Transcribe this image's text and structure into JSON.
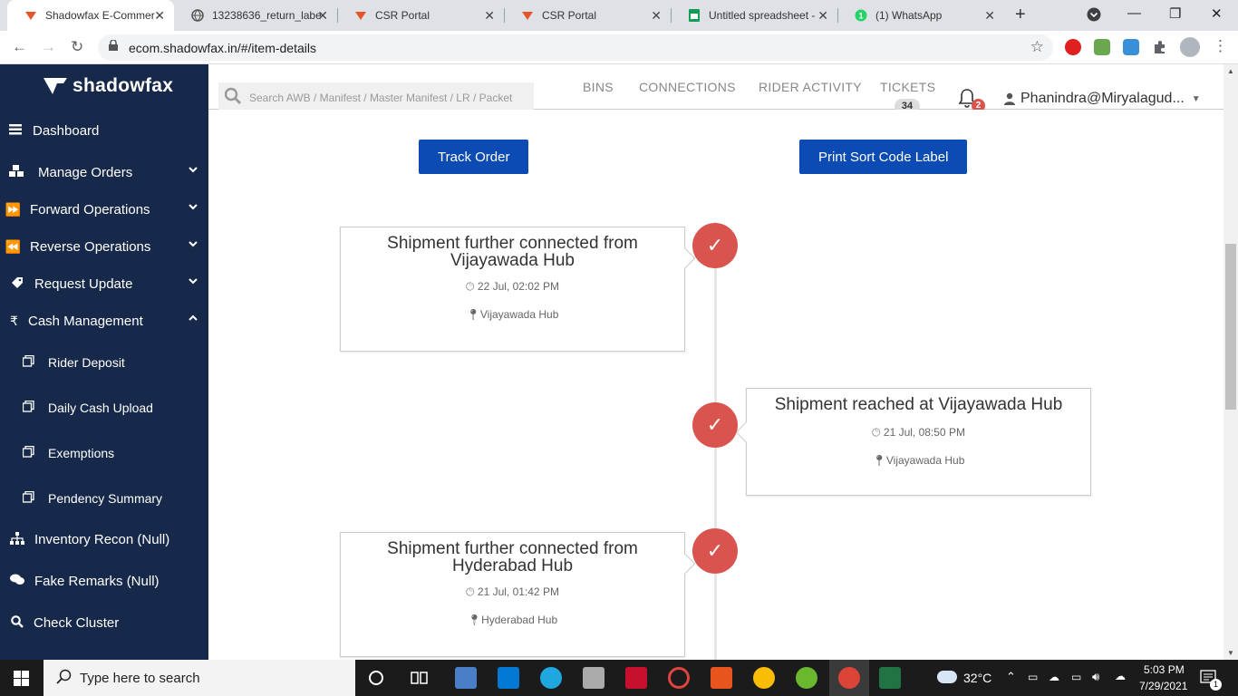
{
  "browser": {
    "tabs": [
      {
        "title": "Shadowfax E-Commer",
        "active": true
      },
      {
        "title": "13238636_return_label"
      },
      {
        "title": "CSR Portal"
      },
      {
        "title": "CSR Portal"
      },
      {
        "title": "Untitled spreadsheet -"
      },
      {
        "title": "(1) WhatsApp"
      }
    ],
    "url": "ecom.shadowfax.in/#/item-details"
  },
  "sidebar": {
    "brand": "shadowfax",
    "items": [
      {
        "label": "Dashboard"
      },
      {
        "label": "Manage Orders"
      },
      {
        "label": "Forward Operations"
      },
      {
        "label": "Reverse Operations"
      },
      {
        "label": "Request Update"
      },
      {
        "label": "Cash Management"
      },
      {
        "label": "Rider Deposit"
      },
      {
        "label": "Daily Cash Upload"
      },
      {
        "label": "Exemptions"
      },
      {
        "label": "Pendency Summary"
      },
      {
        "label": "Inventory Recon (Null)"
      },
      {
        "label": "Fake Remarks (Null)"
      },
      {
        "label": "Check Cluster"
      }
    ]
  },
  "header": {
    "search_placeholder": "Search AWB / Manifest / Master Manifest / LR / Packet",
    "nav": [
      "BINS",
      "CONNECTIONS",
      "RIDER ACTIVITY",
      "TICKETS"
    ],
    "tickets_count": "34",
    "notifications_count": "2",
    "user": "Phanindra@Miryalagud..."
  },
  "actions": {
    "track_order": "Track Order",
    "print_label": "Print Sort Code Label"
  },
  "timeline": [
    {
      "title": "Shipment further connected from Vijayawada Hub",
      "time": "22 Jul, 02:02 PM",
      "location": "Vijayawada Hub"
    },
    {
      "title": "Shipment reached at Vijayawada Hub",
      "time": "21 Jul, 08:50 PM",
      "location": "Vijayawada Hub"
    },
    {
      "title": "Shipment further connected from Hyderabad Hub",
      "time": "21 Jul, 01:42 PM",
      "location": "Hyderabad Hub"
    }
  ],
  "taskbar": {
    "search_placeholder": "Type here to search",
    "weather": "32°C",
    "time": "5:03 PM",
    "date": "7/29/2021",
    "notif_count": "1"
  },
  "colors": {
    "sidebar_bg": "#17294a",
    "primary_button": "#0b4bb3",
    "check_red": "#d9534f"
  }
}
